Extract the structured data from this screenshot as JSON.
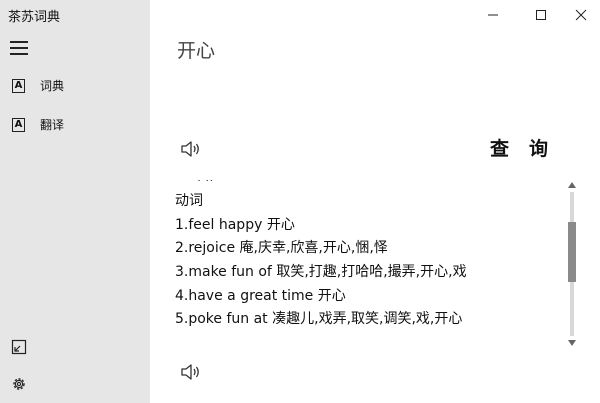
{
  "app": {
    "title": "茶苏词典"
  },
  "sidebar": {
    "items": [
      {
        "label": "词典",
        "icon": "dictionary-icon"
      },
      {
        "label": "翻译",
        "icon": "translate-icon"
      }
    ],
    "bottom_icons": [
      "expand-icon",
      "gear-icon"
    ]
  },
  "window_controls": [
    "minimize-icon",
    "maximize-icon",
    "close-icon"
  ],
  "main": {
    "query_word": "开心",
    "query_button": "查询",
    "results": {
      "part_of_speech": "动词",
      "definitions": [
        "1.feel happy 开心",
        "2.rejoice 庵,庆幸,欣喜,开心,悃,怿",
        "3.make fun of 取笑,打趣,打哈哈,撮弄,开心,戏",
        "4.have a great time 开心",
        "5.poke fun at 凑趣儿,戏弄,取笑,调笑,戏,开心"
      ]
    }
  }
}
